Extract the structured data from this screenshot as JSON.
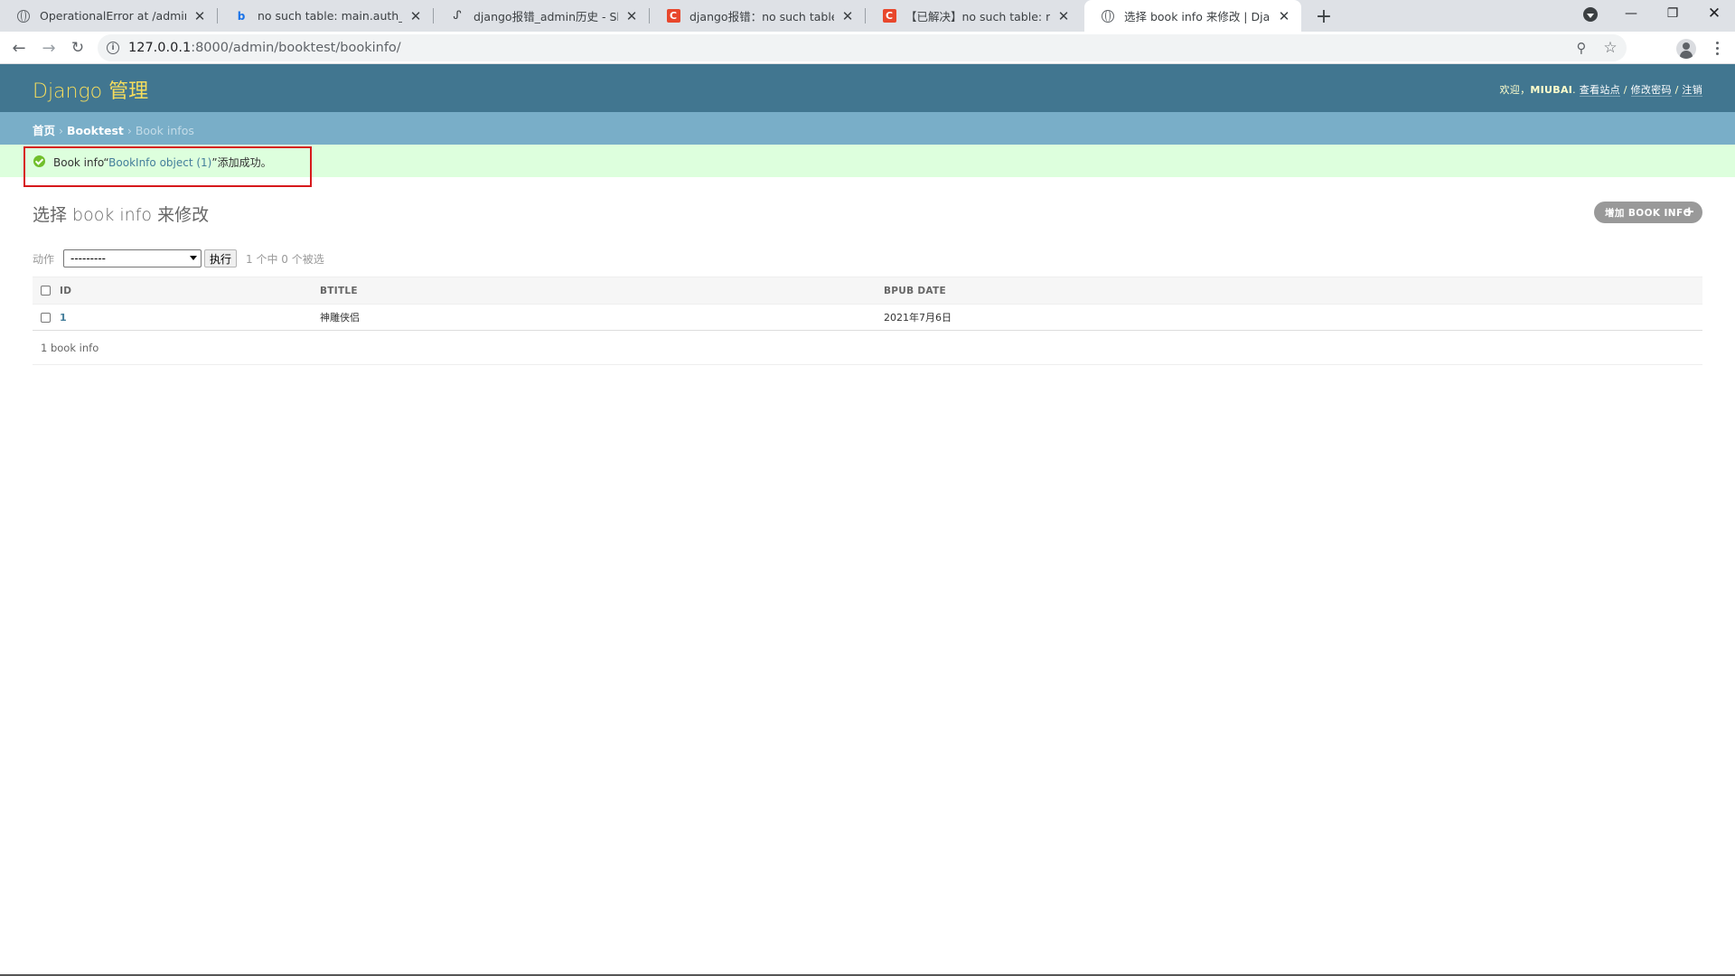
{
  "browser": {
    "tabs": [
      {
        "title": "OperationalError at /admin/bo",
        "icon": "globe-icon"
      },
      {
        "title": "no such table: main.auth_user",
        "icon": "bing-icon"
      },
      {
        "title": "django报错_admin历史 - Shaw",
        "icon": "link-icon"
      },
      {
        "title": "django报错：no such table: ma",
        "icon": "csdn-icon"
      },
      {
        "title": "【已解决】no such table: main",
        "icon": "csdn-icon"
      },
      {
        "title": "选择 book info 来修改 | Django",
        "icon": "globe-icon",
        "active": true
      }
    ],
    "url_host": "127.0.0.1",
    "url_rest": ":8000/admin/booktest/bookinfo/"
  },
  "header": {
    "branding": "Django 管理",
    "welcome": "欢迎，",
    "username": "MIUBAI",
    "username_suffix": ".",
    "view_site": "查看站点",
    "sep1": " / ",
    "change_password": "修改密码",
    "sep2": " / ",
    "logout": "注销"
  },
  "breadcrumbs": {
    "home": "首页",
    "app": "Booktest",
    "current": "Book infos",
    "sep": " › "
  },
  "message": {
    "prefix": "Book info“",
    "link": "BookInfo object (1)",
    "suffix": "”添加成功。"
  },
  "content": {
    "title": "选择 book info 来修改",
    "add_button": "增加 BOOK INFO",
    "actions_label": "动作",
    "action_selected": "---------",
    "go_button": "执行",
    "action_counter": "1 个中 0 个被选",
    "columns": [
      "ID",
      "BTITLE",
      "BPUB DATE"
    ],
    "rows": [
      {
        "id": "1",
        "btitle": "神雕侠侣",
        "bpub_date": "2021年7月6日"
      }
    ],
    "paginator": "1 book info"
  }
}
